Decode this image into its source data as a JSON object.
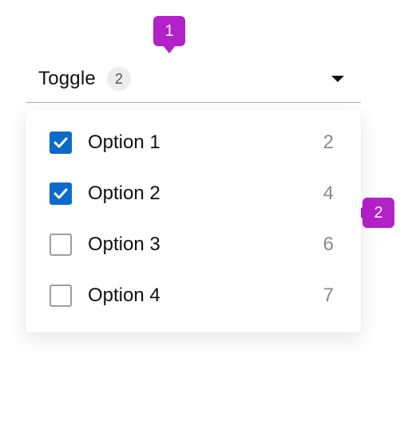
{
  "header": {
    "title": "Toggle",
    "selected_count": "2"
  },
  "options": [
    {
      "label": "Option 1",
      "count": "2",
      "checked": true
    },
    {
      "label": "Option 2",
      "count": "4",
      "checked": true
    },
    {
      "label": "Option 3",
      "count": "6",
      "checked": false
    },
    {
      "label": "Option 4",
      "count": "7",
      "checked": false
    }
  ],
  "callouts": {
    "a": "1",
    "b": "2"
  },
  "colors": {
    "accent": "#0b6bcb",
    "callout": "#b321c9"
  }
}
